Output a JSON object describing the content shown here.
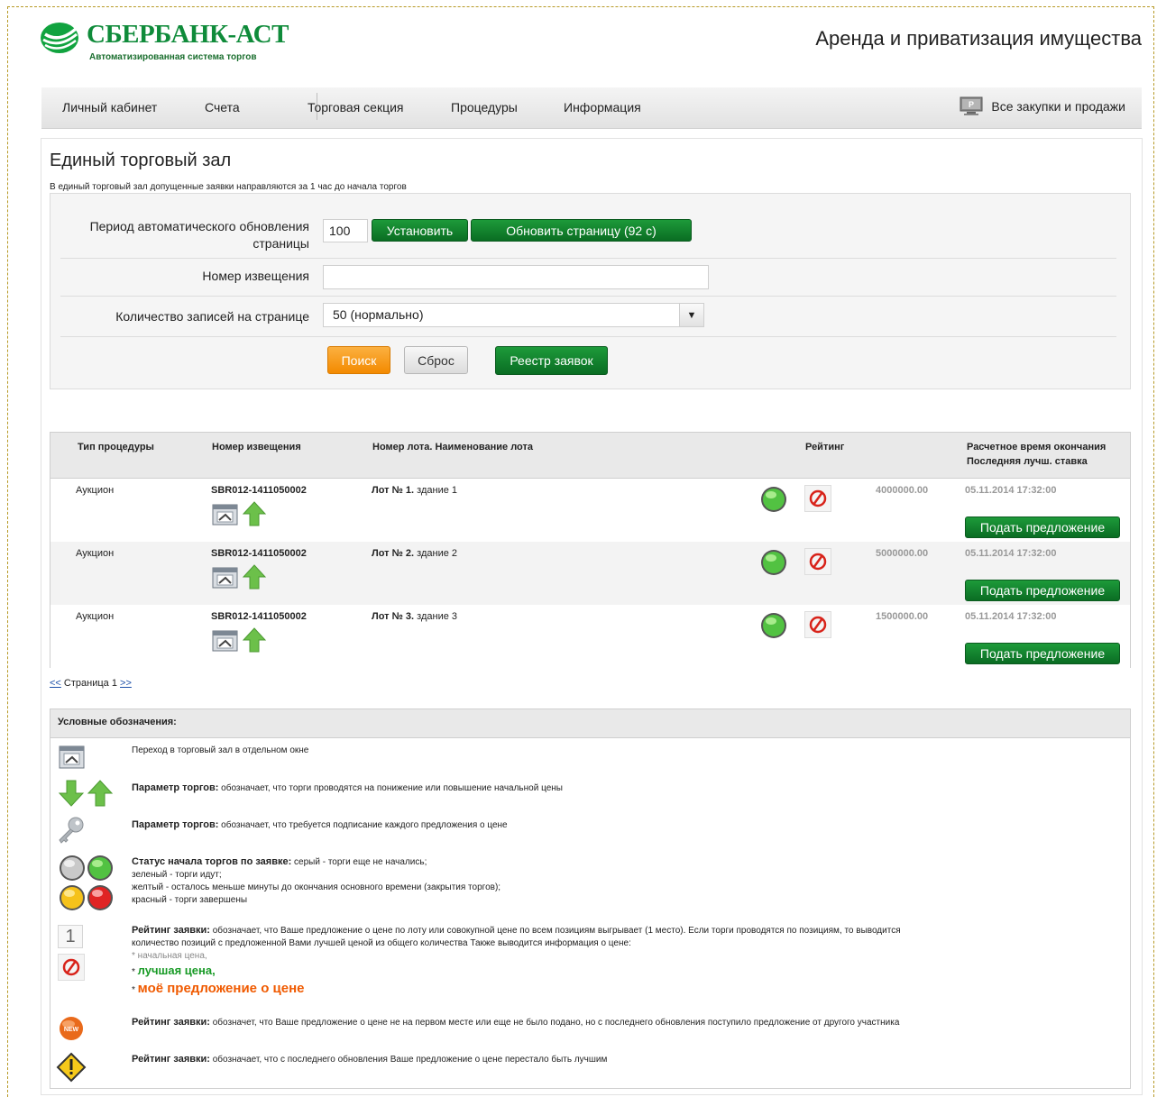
{
  "header": {
    "logo_name": "СБЕРБАНК-АСТ",
    "logo_sub": "Автоматизированная система торгов",
    "site_title": "Аренда и приватизация имущества"
  },
  "nav": {
    "items": [
      {
        "label": "Личный кабинет"
      },
      {
        "label": "Счета"
      },
      {
        "label": "Торговая секция"
      },
      {
        "label": "Процедуры"
      },
      {
        "label": "Информация"
      }
    ],
    "all_purchases": "Все закупки и продажи"
  },
  "page": {
    "title": "Единый торговый зал",
    "note": "В единый торговый зал допущенные заявки направляются за 1 час до начала торгов"
  },
  "form": {
    "refresh_label": "Период автоматического обновления страницы",
    "refresh_value": "100",
    "set_button": "Установить",
    "refresh_button": "Обновить страницу (92 с)",
    "notice_label": "Номер извещения",
    "notice_value": "",
    "records_label": "Количество записей на странице",
    "records_selected": "50 (нормально)",
    "search_button": "Поиск",
    "reset_button": "Сброс",
    "registry_button": "Реестр заявок"
  },
  "table": {
    "headers": {
      "type": "Тип процедуры",
      "notice": "Номер извещения",
      "lot": "Номер лота. Наименование лота",
      "rating": "Рейтинг",
      "end_time_1": "Расчетное время окончания",
      "end_time_2": "Последняя лучш. ставка"
    },
    "rows": [
      {
        "type": "Аукцион",
        "notice": "SBR012-1411050002",
        "lot_no": "Лот № 1.",
        "lot_name": "здание 1",
        "price": "4000000.00",
        "end_time": "05.11.2014 17:32:00",
        "action": "Подать предложение"
      },
      {
        "type": "Аукцион",
        "notice": "SBR012-1411050002",
        "lot_no": "Лот № 2.",
        "lot_name": "здание 2",
        "price": "5000000.00",
        "end_time": "05.11.2014 17:32:00",
        "action": "Подать предложение"
      },
      {
        "type": "Аукцион",
        "notice": "SBR012-1411050002",
        "lot_no": "Лот № 3.",
        "lot_name": "здание 3",
        "price": "1500000.00",
        "end_time": "05.11.2014 17:32:00",
        "action": "Подать предложение"
      }
    ]
  },
  "pager": {
    "prev": "<<",
    "label": "Страница 1",
    "next": ">>"
  },
  "legend": {
    "title": "Условные обозначения:",
    "item1": "Переход в торговый зал в отдельном окне",
    "item2_bold": "Параметр торгов:",
    "item2_text": " обозначает, что торги проводятся на понижение или повышение начальной цены",
    "item3_bold": "Параметр торгов:",
    "item3_text": " обозначает, что требуется подписание каждого предложения о цене",
    "item4_bold": "Статус начала торгов по заявке:",
    "item4_line1": " серый - торги еще не начались;",
    "item4_line2": "зеленый - торги идут;",
    "item4_line3": "желтый - осталось меньше минуты до окончания основного времени (закрытия торгов);",
    "item4_line4": "красный - торги завершены",
    "item5_bold": "Рейтинг заявки:",
    "item5_line1": " обозначает, что Ваше предложение о цене по лоту или совокупной цене по всем позициям выгрывает (1 место). Если торги проводятся по позициям, то выводится",
    "item5_line2": "количество позиций с предложенной Вами лучшей ценой из общего количества Также выводится информация о цене:",
    "item5_start": "начальная цена,",
    "item5_best": "лучшая цена,",
    "item5_mine": "моё предложение о цене",
    "item5_digit": "1",
    "item6_bold": "Рейтинг заявки:",
    "item6_text": " обозначет, что Ваше предложение о цене не на первом месте или еще не было подано, но с последнего обновления поступило предложение от другого участника",
    "item6_badge": "NEW",
    "item7_bold": "Рейтинг заявки:",
    "item7_text": " обозначает, что с последнего обновления Ваше предложение о цене перестало быть лучшим"
  },
  "colors": {
    "brand_green": "#0f8b3a",
    "button_green": "#0a6d23",
    "button_orange": "#f38a00",
    "frame_dashed": "#b79a26"
  }
}
